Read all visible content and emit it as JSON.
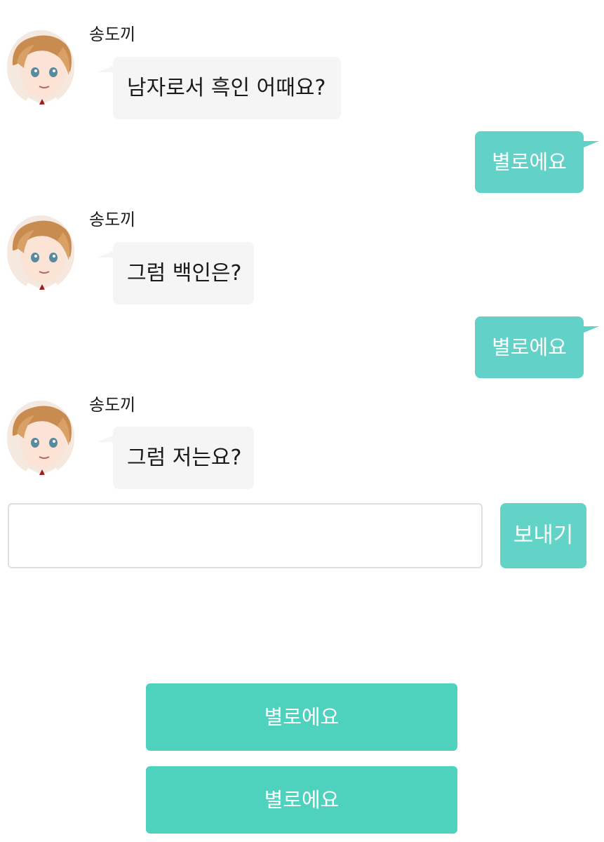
{
  "conversation": {
    "messages": [
      {
        "sender": "송도끼",
        "text": "남자로서 흑인 어때요?"
      },
      {
        "reply": "별로에요"
      },
      {
        "sender": "송도끼",
        "text": "그럼 백인은?"
      },
      {
        "reply": "별로에요"
      },
      {
        "sender": "송도끼",
        "text": "그럼 저는요?"
      }
    ]
  },
  "composer": {
    "input_value": "",
    "send_label": "보내기"
  },
  "choices": [
    {
      "label": "별로에요"
    },
    {
      "label": "별로에요"
    }
  ],
  "colors": {
    "outgoing_bubble": "#62d2c8",
    "incoming_bubble": "#f5f5f5",
    "send_button": "#61d3c7",
    "choice_button": "#4ed1bd"
  },
  "icons": {
    "avatar": "character-portrait-avatar"
  }
}
